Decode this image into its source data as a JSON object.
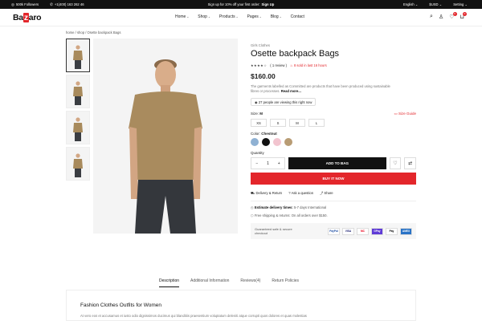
{
  "topbar": {
    "followers": "500k Followers",
    "phone": "+1(400) 163 262 46",
    "promo": "Sign up for 10% off your first order:",
    "promo_link": "Sign Up",
    "language": "English",
    "currency": "$USD",
    "setting": "Setting"
  },
  "header": {
    "logo_pre": "Ba",
    "logo_mid": "z",
    "logo_post": "aro",
    "nav": [
      "Home",
      "Shop",
      "Products",
      "Pages",
      "Blog",
      "Contact"
    ],
    "wishlist_count": "0",
    "cart_count": "0"
  },
  "breadcrumb": "home / shop / Osette backpack Bags",
  "product": {
    "category": "Girls Clothes",
    "title": "Osette backpack Bags",
    "stars": "★★★★☆",
    "reviews": "( 1 review )",
    "sold": "8 sold in last 16 hours",
    "price": "$160.00",
    "description": "The garments labelled as Committed are products that have been produced using sustainable fibres or processes.",
    "read_more": "Read more...",
    "viewing": "27 people are viewing this right now",
    "size_label": "Size:",
    "size_selected": "M",
    "size_guide": "Size Guide",
    "sizes": [
      "XS",
      "S",
      "M",
      "L"
    ],
    "color_label": "Color:",
    "color_selected": "Chestnut",
    "colors": [
      "#8fb1d3",
      "#111111",
      "#f2c4cf",
      "#b89c74"
    ],
    "quantity_label": "Quantity",
    "quantity": "1",
    "add_to_bag": "ADD TO BAG",
    "buy_now": "BUY IT NOW",
    "links": [
      "Delivery & Return",
      "Ask a question",
      "Share"
    ],
    "delivery_label": "Estimate delivery times:",
    "delivery_value": "5-7 days International",
    "shipping_label": "Free shipping & returns:",
    "shipping_value": "On all orders over $150.",
    "checkout_text": "Guaranteed safe & secure checkout",
    "payments": [
      "PayPal",
      "VISA",
      "MC",
      "GPay",
      "Pay",
      "AMEX"
    ]
  },
  "tabs": [
    "Description",
    "Additional Information",
    "Reviews(4)",
    "Return Policies"
  ],
  "description_section": {
    "title": "Fashion Clothes Outfits for Women",
    "text": "At vero eos et accusamus et iusto odio dignissimos ducimus qui blanditiis praesentium voluptatum deleniti atque corrupti quos dolores et quas molestias"
  }
}
